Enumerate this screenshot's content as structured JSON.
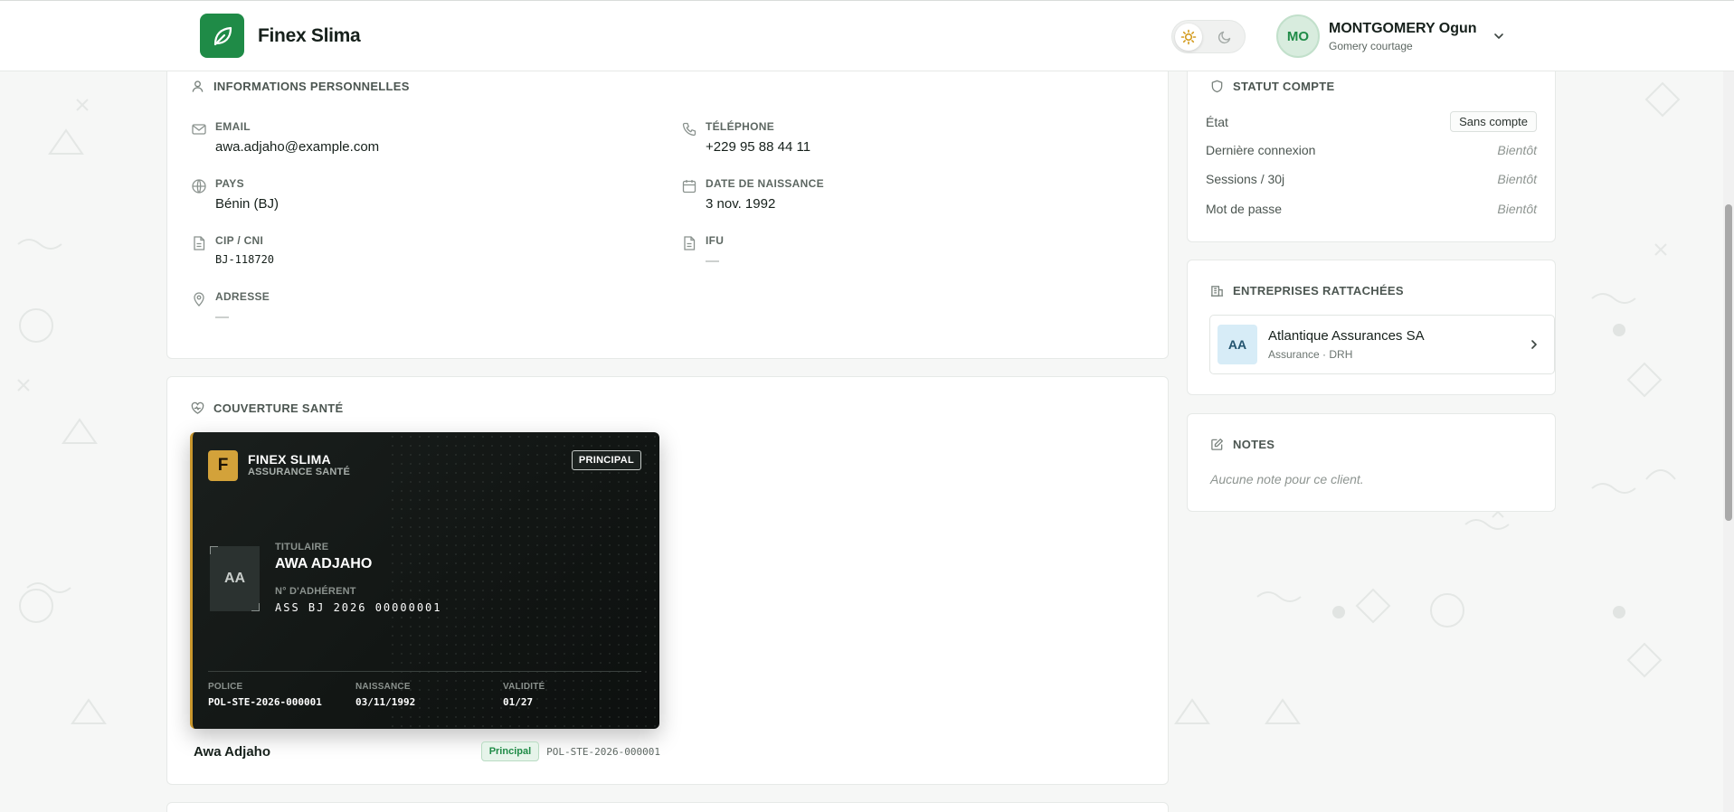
{
  "header": {
    "brand_name": "Finex Slima",
    "user": {
      "initials": "MO",
      "name": "MONTGOMERY Ogun",
      "company": "Gomery courtage"
    }
  },
  "personal_info": {
    "title": "INFORMATIONS PERSONNELLES",
    "fields": {
      "email": {
        "label": "EMAIL",
        "value": "awa.adjaho@example.com"
      },
      "phone": {
        "label": "TÉLÉPHONE",
        "value": "+229 95 88 44 11"
      },
      "country": {
        "label": "PAYS",
        "value": "Bénin (BJ)"
      },
      "birthdate": {
        "label": "DATE DE NAISSANCE",
        "value": "3 nov. 1992"
      },
      "id_number": {
        "label": "CIP / CNI",
        "value": "BJ-118720"
      },
      "ifu": {
        "label": "IFU",
        "value": "—"
      },
      "address": {
        "label": "ADRESSE",
        "value": "—"
      }
    }
  },
  "coverage": {
    "title": "COUVERTURE SANTÉ",
    "card": {
      "logo_letter": "F",
      "brand": "FINEX SLIMA",
      "brand_sub": "ASSURANCE SANTÉ",
      "tag": "PRINCIPAL",
      "photo_initials": "AA",
      "holder_label": "TITULAIRE",
      "holder_name": "AWA ADJAHO",
      "member_label": "N° D'ADHÉRENT",
      "member_number": "ASS BJ 2026 00000001",
      "policy_label": "POLICE",
      "policy_value": "POL-STE-2026-000001",
      "birth_label": "NAISSANCE",
      "birth_value": "03/11/1992",
      "validity_label": "VALIDITÉ",
      "validity_value": "01/27"
    },
    "holder_row": {
      "name": "Awa Adjaho",
      "badge": "Principal",
      "policy": "POL-STE-2026-000001"
    }
  },
  "account_status": {
    "title": "STATUT COMPTE",
    "rows": [
      {
        "label": "État",
        "value": "Sans compte"
      },
      {
        "label": "Dernière connexion",
        "value": "Bientôt"
      },
      {
        "label": "Sessions / 30j",
        "value": "Bientôt"
      },
      {
        "label": "Mot de passe",
        "value": "Bientôt"
      }
    ]
  },
  "companies": {
    "title": "ENTREPRISES RATTACHÉES",
    "items": [
      {
        "initials": "AA",
        "name": "Atlantique Assurances SA",
        "sub": "Assurance · DRH"
      }
    ]
  },
  "notes": {
    "title": "NOTES",
    "empty": "Aucune note pour ce client."
  },
  "colors": {
    "brand_green": "#1f8b47",
    "card_dark": "#121614",
    "card_gold": "#d3a23a"
  }
}
